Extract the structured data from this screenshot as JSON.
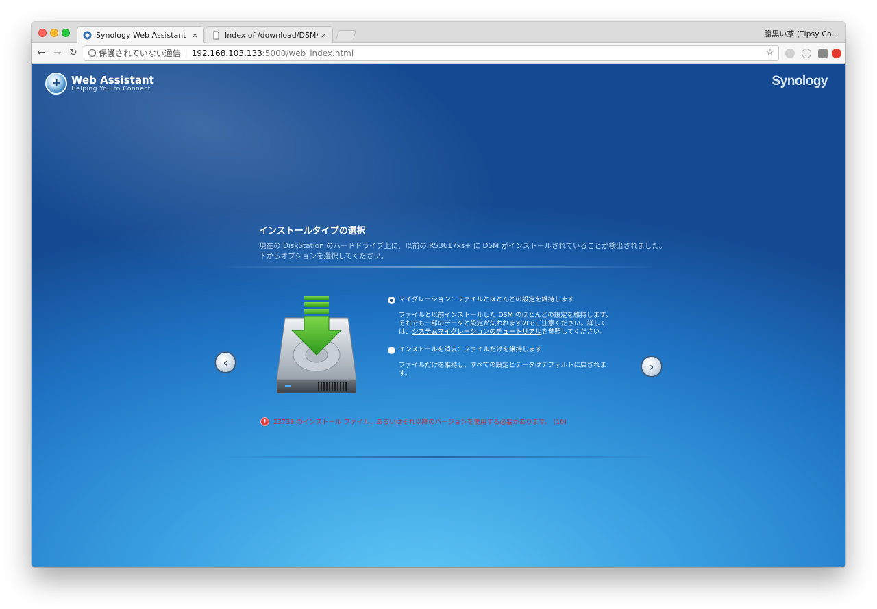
{
  "browser": {
    "tabs": [
      {
        "label": "Synology Web Assistant",
        "close": "×"
      },
      {
        "label": "Index of /download/DSM/releas",
        "close": "×"
      }
    ],
    "profile": "腹黒い茶 (Tipsy Co...",
    "url": {
      "security_label": "保護されていない通信",
      "host": "192.168.103.133",
      "path": ":5000/web_index.html"
    },
    "nav": {
      "back": "←",
      "forward": "→",
      "reload": "↻",
      "bookmark": "☆"
    }
  },
  "brand": {
    "title": "Web Assistant",
    "subtitle": "Helping You to Connect",
    "vendor": "Synology"
  },
  "wizard": {
    "heading": "インストールタイプの選択",
    "description": "現在の DiskStation のハードドライブ上に、以前の RS3617xs+ に DSM がインストールされていることが検出されました。下からオプションを選択してください。",
    "prev": "‹",
    "next": "›",
    "options": [
      {
        "label": "マイグレーション：ファイルとほとんどの設定を維持します",
        "selected": true,
        "desc_before": "ファイルと以前インストールした DSM のほとんどの設定を維持します。それでも一部のデータと設定が失われますのでご注意ください。詳しくは、",
        "desc_link": "システムマイグレーションのチュートリアル",
        "desc_after": "を参照してください。"
      },
      {
        "label": "インストールを消去：ファイルだけを維持します",
        "selected": false,
        "desc": "ファイルだけを維持し、すべての設定とデータはデフォルトに戻されます。"
      }
    ],
    "warning": "23739 のインストール ファイル、あるいはそれ以降のバージョンを使用する必要があります。 (10)"
  },
  "colors": {
    "accent_green": "#3fae2a",
    "warning_red": "#c9303a",
    "bg_blue": "#1f73c4"
  }
}
